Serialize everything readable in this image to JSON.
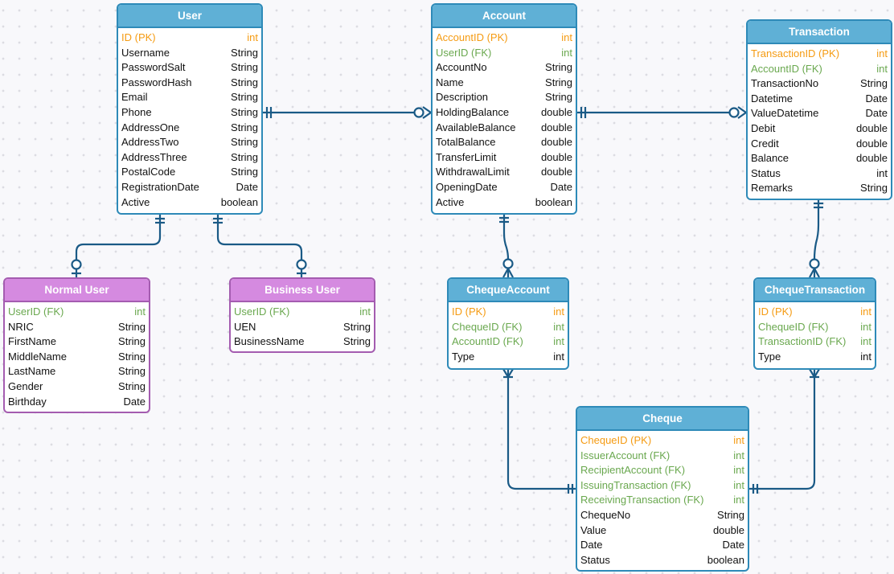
{
  "colors": {
    "entity_header": "#5fb0d6",
    "entity_border": "#2e8ab8",
    "subtype_header": "#d58ae0",
    "subtype_border": "#a45cb0",
    "primary_key": "#f59b12",
    "foreign_key": "#6aa84f",
    "connector": "#1a5a86"
  },
  "entities": {
    "user": {
      "title": "User",
      "fields": [
        {
          "name": "ID (PK)",
          "type": "int",
          "key": "pk"
        },
        {
          "name": "Username",
          "type": "String",
          "key": ""
        },
        {
          "name": "PasswordSalt",
          "type": "String",
          "key": ""
        },
        {
          "name": "PasswordHash",
          "type": "String",
          "key": ""
        },
        {
          "name": "Email",
          "type": "String",
          "key": ""
        },
        {
          "name": "Phone",
          "type": "String",
          "key": ""
        },
        {
          "name": "AddressOne",
          "type": "String",
          "key": ""
        },
        {
          "name": "AddressTwo",
          "type": "String",
          "key": ""
        },
        {
          "name": "AddressThree",
          "type": "String",
          "key": ""
        },
        {
          "name": "PostalCode",
          "type": "String",
          "key": ""
        },
        {
          "name": "RegistrationDate",
          "type": "Date",
          "key": ""
        },
        {
          "name": "Active",
          "type": "boolean",
          "key": ""
        }
      ]
    },
    "account": {
      "title": "Account",
      "fields": [
        {
          "name": "AccountID (PK)",
          "type": "int",
          "key": "pk"
        },
        {
          "name": "UserID (FK)",
          "type": "int",
          "key": "fk"
        },
        {
          "name": "AccountNo",
          "type": "String",
          "key": ""
        },
        {
          "name": "Name",
          "type": "String",
          "key": ""
        },
        {
          "name": "Description",
          "type": "String",
          "key": ""
        },
        {
          "name": "HoldingBalance",
          "type": "double",
          "key": ""
        },
        {
          "name": "AvailableBalance",
          "type": "double",
          "key": ""
        },
        {
          "name": "TotalBalance",
          "type": "double",
          "key": ""
        },
        {
          "name": "TransferLimit",
          "type": "double",
          "key": ""
        },
        {
          "name": "WithdrawalLimit",
          "type": "double",
          "key": ""
        },
        {
          "name": "OpeningDate",
          "type": "Date",
          "key": ""
        },
        {
          "name": "Active",
          "type": "boolean",
          "key": ""
        }
      ]
    },
    "transaction": {
      "title": "Transaction",
      "fields": [
        {
          "name": "TransactionID (PK)",
          "type": "int",
          "key": "pk"
        },
        {
          "name": "AccountID (FK)",
          "type": "int",
          "key": "fk"
        },
        {
          "name": "TransactionNo",
          "type": "String",
          "key": ""
        },
        {
          "name": "Datetime",
          "type": "Date",
          "key": ""
        },
        {
          "name": "ValueDatetime",
          "type": "Date",
          "key": ""
        },
        {
          "name": "Debit",
          "type": "double",
          "key": ""
        },
        {
          "name": "Credit",
          "type": "double",
          "key": ""
        },
        {
          "name": "Balance",
          "type": "double",
          "key": ""
        },
        {
          "name": "Status",
          "type": "int",
          "key": ""
        },
        {
          "name": "Remarks",
          "type": "String",
          "key": ""
        }
      ]
    },
    "normal_user": {
      "title": "Normal User",
      "fields": [
        {
          "name": "UserID (FK)",
          "type": "int",
          "key": "fk"
        },
        {
          "name": "NRIC",
          "type": "String",
          "key": ""
        },
        {
          "name": "FirstName",
          "type": "String",
          "key": ""
        },
        {
          "name": "MiddleName",
          "type": "String",
          "key": ""
        },
        {
          "name": "LastName",
          "type": "String",
          "key": ""
        },
        {
          "name": "Gender",
          "type": "String",
          "key": ""
        },
        {
          "name": "Birthday",
          "type": "Date",
          "key": ""
        }
      ]
    },
    "business_user": {
      "title": "Business User",
      "fields": [
        {
          "name": "UserID (FK)",
          "type": "int",
          "key": "fk"
        },
        {
          "name": "UEN",
          "type": "String",
          "key": ""
        },
        {
          "name": "BusinessName",
          "type": "String",
          "key": ""
        }
      ]
    },
    "cheque_account": {
      "title": "ChequeAccount",
      "fields": [
        {
          "name": "ID (PK)",
          "type": "int",
          "key": "pk"
        },
        {
          "name": "ChequeID (FK)",
          "type": "int",
          "key": "fk"
        },
        {
          "name": "AccountID (FK)",
          "type": "int",
          "key": "fk"
        },
        {
          "name": "Type",
          "type": "int",
          "key": ""
        }
      ]
    },
    "cheque_transaction": {
      "title": "ChequeTransaction",
      "fields": [
        {
          "name": "ID (PK)",
          "type": "int",
          "key": "pk"
        },
        {
          "name": "ChequeID (FK)",
          "type": "int",
          "key": "fk"
        },
        {
          "name": "TransactionID  (FK)",
          "type": "int",
          "key": "fk"
        },
        {
          "name": "Type",
          "type": "int",
          "key": ""
        }
      ]
    },
    "cheque": {
      "title": "Cheque",
      "fields": [
        {
          "name": "ChequeID (PK)",
          "type": "int",
          "key": "pk"
        },
        {
          "name": "IssuerAccount (FK)",
          "type": "int",
          "key": "fk"
        },
        {
          "name": "RecipientAccount (FK)",
          "type": "int",
          "key": "fk"
        },
        {
          "name": "IssuingTransaction  (FK)",
          "type": "int",
          "key": "fk"
        },
        {
          "name": "ReceivingTransaction  (FK)",
          "type": "int",
          "key": "fk"
        },
        {
          "name": "ChequeNo",
          "type": "String",
          "key": ""
        },
        {
          "name": "Value",
          "type": "double",
          "key": ""
        },
        {
          "name": "Date",
          "type": "Date",
          "key": ""
        },
        {
          "name": "Status",
          "type": "boolean",
          "key": ""
        }
      ]
    }
  },
  "relationships": [
    {
      "from": "User",
      "to": "Account",
      "from_cardinality": "one-and-only-one",
      "to_cardinality": "zero-or-many"
    },
    {
      "from": "Account",
      "to": "Transaction",
      "from_cardinality": "one-and-only-one",
      "to_cardinality": "zero-or-many"
    },
    {
      "from": "User",
      "to": "Normal User",
      "from_cardinality": "one-and-only-one",
      "to_cardinality": "zero-or-one"
    },
    {
      "from": "User",
      "to": "Business User",
      "from_cardinality": "one-and-only-one",
      "to_cardinality": "zero-or-one"
    },
    {
      "from": "Account",
      "to": "ChequeAccount",
      "from_cardinality": "one-and-only-one",
      "to_cardinality": "zero-or-many"
    },
    {
      "from": "Transaction",
      "to": "ChequeTransaction",
      "from_cardinality": "one-and-only-one",
      "to_cardinality": "zero-or-many"
    },
    {
      "from": "Cheque",
      "to": "ChequeAccount",
      "from_cardinality": "one-and-only-one",
      "to_cardinality": "one-or-many"
    },
    {
      "from": "Cheque",
      "to": "ChequeTransaction",
      "from_cardinality": "one-and-only-one",
      "to_cardinality": "one-or-many"
    }
  ]
}
